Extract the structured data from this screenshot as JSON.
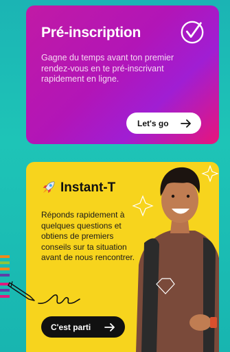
{
  "preinscription": {
    "title": "Pré-inscription",
    "description": "Gagne du temps avant ton premier rendez-vous en te pré-inscrivant rapidement en ligne.",
    "button_label": "Let's go",
    "button_icon": "arrow-right-icon",
    "badge_icon": "check-circle-icon"
  },
  "instant_t": {
    "title": "Instant-T",
    "title_icon": "rocket-icon",
    "description": "Réponds rapidement à quelques questions et obtiens de premiers conseils sur ta situation avant de nous rencontrer.",
    "button_label": "C'est parti",
    "button_icon": "arrow-right-icon",
    "signature_icon": "signature-icon"
  },
  "colors": {
    "background": "#1bb4b4",
    "card1_start": "#c11aa5",
    "card1_end": "#e8157a",
    "card2": "#f7d41d"
  }
}
